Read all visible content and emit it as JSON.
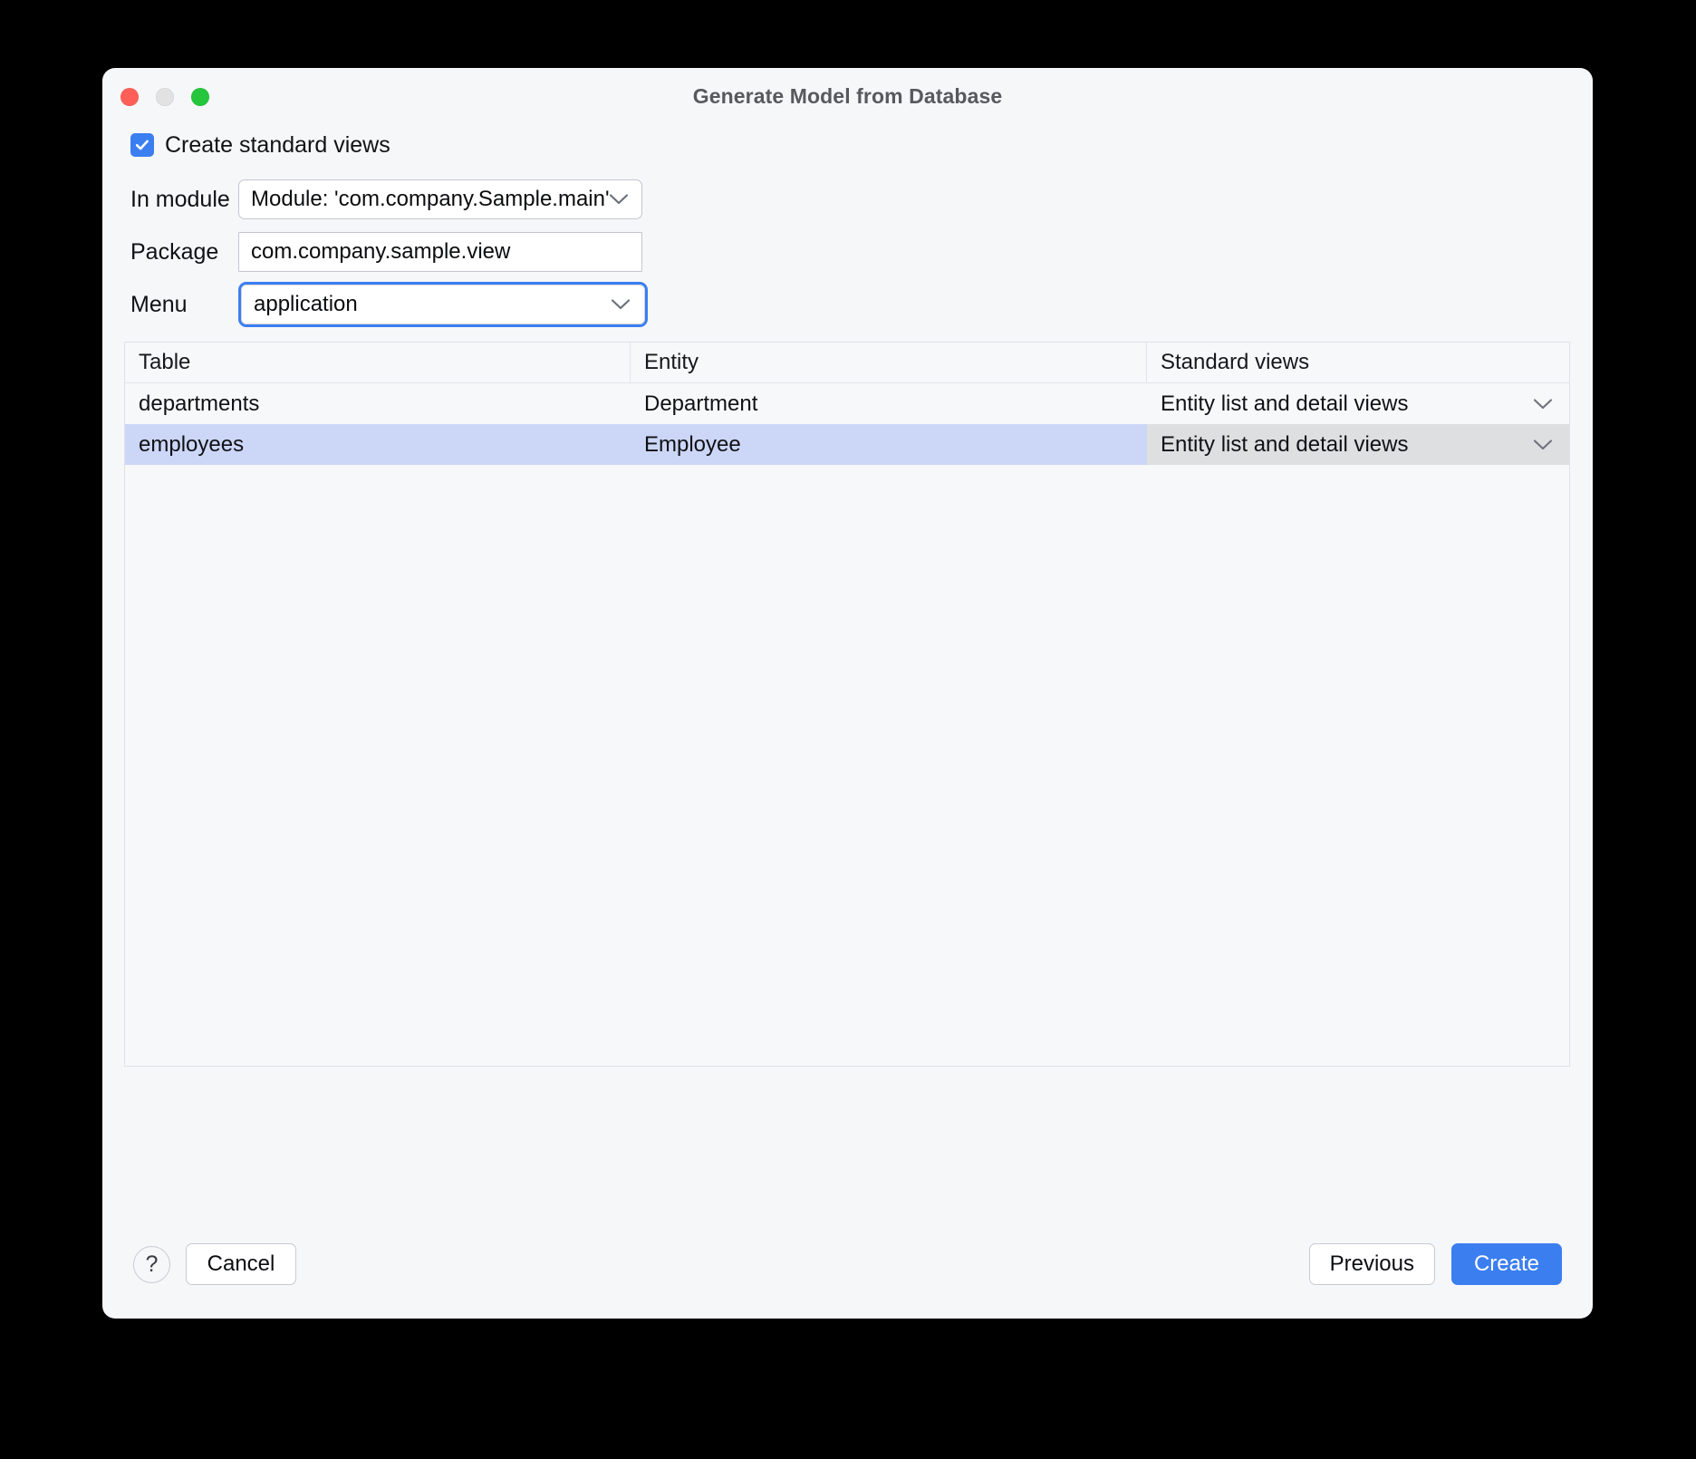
{
  "window": {
    "title": "Generate Model from Database",
    "traffic_lights": [
      {
        "name": "close",
        "color": "#ff5f57"
      },
      {
        "name": "minimize",
        "color": "#e2e2e3"
      },
      {
        "name": "zoom",
        "color": "#25c63b"
      }
    ]
  },
  "options": {
    "create_standard_views_label": "Create standard views",
    "create_standard_views_checked": true
  },
  "form": {
    "module": {
      "label": "In module",
      "value": "Module: 'com.company.Sample.main'",
      "icon": "chevron-down-icon"
    },
    "package": {
      "label": "Package",
      "value": "com.company.sample.view",
      "placeholder": "com.company.sample.view"
    },
    "menu": {
      "label": "Menu",
      "value": "application",
      "icon": "chevron-down-icon",
      "focused": true
    }
  },
  "table": {
    "columns": [
      "Table",
      "Entity",
      "Standard views"
    ],
    "rows": [
      {
        "table": "departments",
        "entity": "Department",
        "views": "Entity list and detail views",
        "selected": false
      },
      {
        "table": "employees",
        "entity": "Employee",
        "views": "Entity list and detail views",
        "selected": true
      }
    ]
  },
  "footer": {
    "help_label": "?",
    "cancel_label": "Cancel",
    "previous_label": "Previous",
    "create_label": "Create"
  },
  "colors": {
    "accent": "#3b7ef0",
    "selection": "#ccd6f7",
    "window_bg": "#f6f7f9",
    "title_text": "#58595c"
  }
}
